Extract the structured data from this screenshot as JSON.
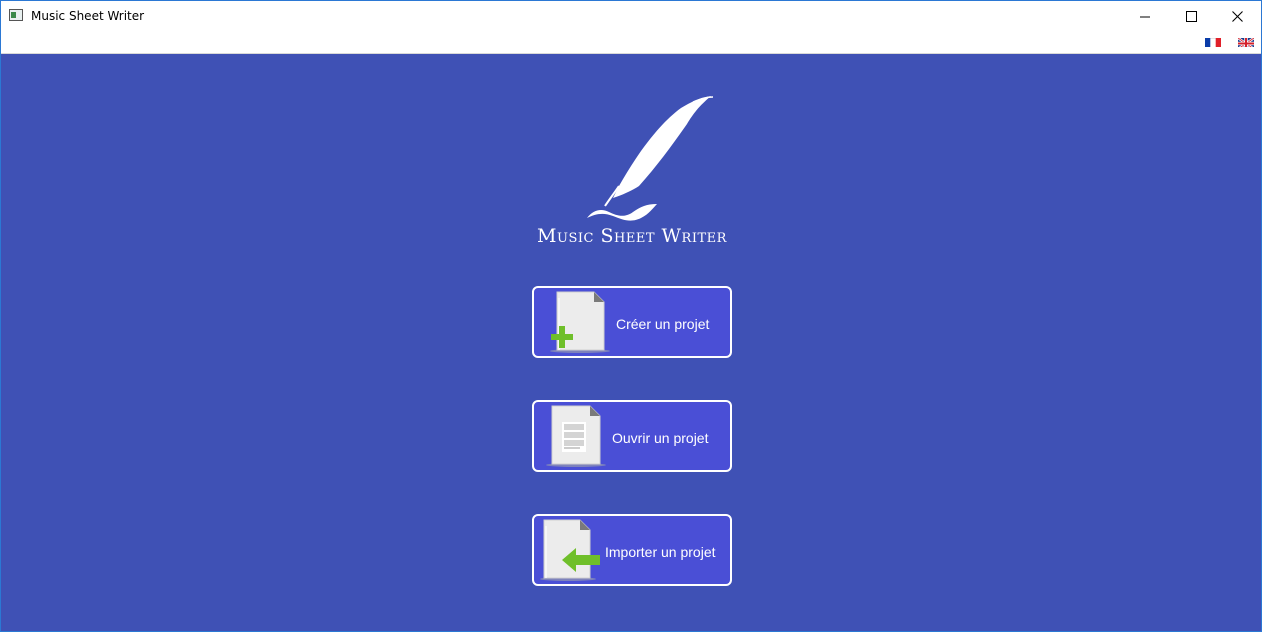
{
  "window": {
    "title": "Music Sheet Writer"
  },
  "titlebar": {
    "minimize_icon": "minimize-icon",
    "maximize_icon": "maximize-icon",
    "close_icon": "close-icon"
  },
  "languages": [
    {
      "code": "fr",
      "icon": "france-flag-icon"
    },
    {
      "code": "en",
      "icon": "uk-flag-icon"
    }
  ],
  "logo": {
    "text": "Music Sheet Writer",
    "icon": "quill-icon"
  },
  "actions": {
    "create_label": "Créer un projet",
    "open_label": "Ouvrir un projet",
    "import_label": "Importer un projet"
  },
  "colors": {
    "background": "#3f51b5",
    "button_fill": "#4a4fd6",
    "button_border": "#ffffff",
    "accent_green": "#6fbf2a"
  }
}
